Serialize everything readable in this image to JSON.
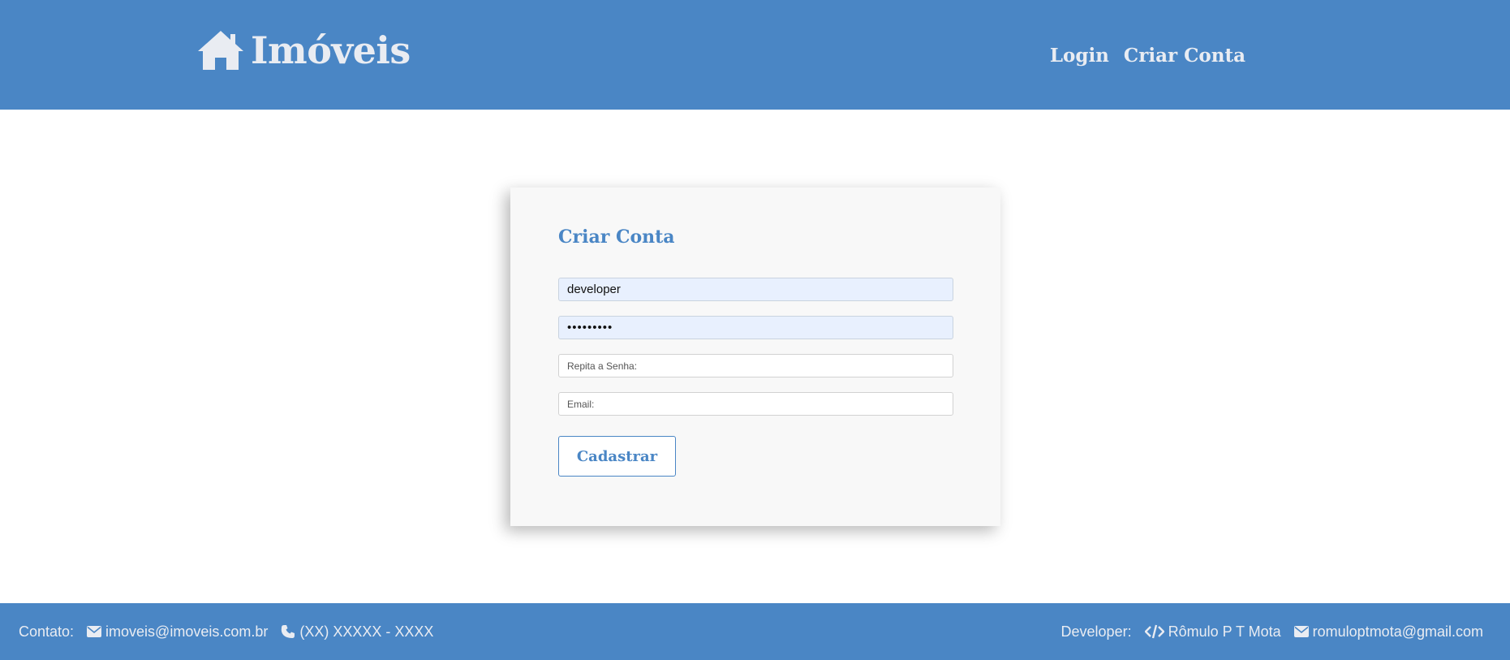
{
  "header": {
    "brand_title": "Imóveis",
    "brand_icon": "home-icon",
    "nav": {
      "login": "Login",
      "signup": "Criar Conta"
    }
  },
  "form": {
    "title": "Criar Conta",
    "username": {
      "value": "developer",
      "placeholder": ""
    },
    "password": {
      "value": "•••••••••",
      "placeholder": ""
    },
    "repeat_password": {
      "value": "",
      "placeholder": "Repita a Senha:"
    },
    "email": {
      "value": "",
      "placeholder": "Email:"
    },
    "submit_label": "Cadastrar"
  },
  "footer": {
    "contact_label": "Contato:",
    "contact_email": "imoveis@imoveis.com.br",
    "contact_phone": "(XX) XXXXX - XXXX",
    "developer_label": "Developer:",
    "developer_name": "Rômulo P T Mota",
    "developer_email": "romuloptmota@gmail.com",
    "icons": [
      "envelope-icon",
      "phone-icon",
      "code-icon",
      "envelope-icon"
    ]
  },
  "colors": {
    "primary": "#4a86c5",
    "header_text": "#e9ecf2",
    "card_bg": "#f8f8f8",
    "autofill_bg": "#e8f0fe"
  }
}
